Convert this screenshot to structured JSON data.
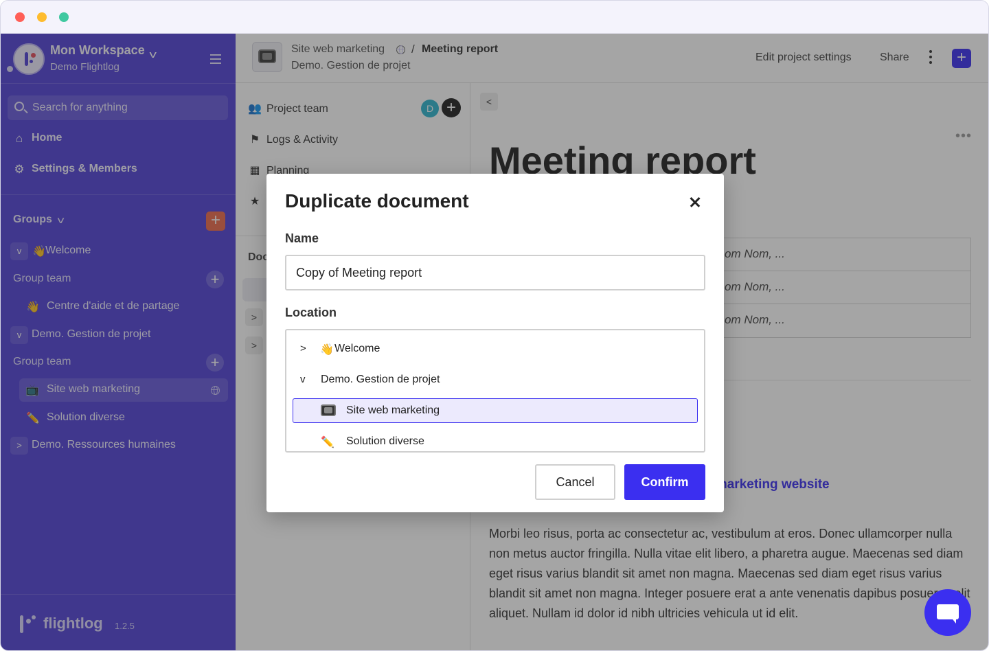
{
  "window": {
    "title_bar": ""
  },
  "workspace": {
    "name": "Mon Workspace",
    "sub": "Demo Flightlog"
  },
  "sidebar": {
    "search_placeholder": "Search for anything",
    "nav": [
      {
        "label": "Home",
        "icon": "home-icon"
      },
      {
        "label": "Settings & Members",
        "icon": "gear-icon"
      }
    ],
    "groups_label": "Groups",
    "tree": [
      {
        "label": "Welcome",
        "emoji": "👋"
      },
      {
        "label": "Group team"
      },
      {
        "label": "Centre d'aide et de partage",
        "emoji": "👋"
      },
      {
        "label": "Demo. Gestion de projet"
      },
      {
        "label": "Group team"
      },
      {
        "label": "Site web marketing",
        "emoji": "📺"
      },
      {
        "label": "Solution diverse",
        "emoji": "✏️"
      },
      {
        "label": "Demo. Ressources humaines"
      }
    ],
    "brand": {
      "name": "flightlog",
      "version": "1.2.5"
    }
  },
  "topbar": {
    "breadcrumb_project": "Site web marketing",
    "breadcrumb_separator": "/",
    "breadcrumb_doc": "Meeting report",
    "breadcrumb_sub": "Demo. Gestion de projet",
    "edit_settings": "Edit project settings",
    "share": "Share"
  },
  "subpanel": {
    "items": [
      {
        "label": "Project team",
        "icon": "team-icon"
      },
      {
        "label": "Logs & Activity",
        "icon": "flag-icon"
      },
      {
        "label": "Planning",
        "icon": "calendar-icon"
      }
    ],
    "avatar_initial": "D",
    "docs_label": "Doc"
  },
  "document": {
    "title": "Meeting report",
    "table_cells": [
      "om Nom, ...",
      "om Nom, ...",
      "om Nom, ..."
    ],
    "link_text": "e marketing website",
    "paragraph": "Morbi leo risus, porta ac consectetur ac, vestibulum at eros. Donec ullamcorper nulla non metus auctor fringilla. Nulla vitae elit libero, a pharetra augue. Maecenas sed diam eget risus varius blandit sit amet non magna. Maecenas sed diam eget risus varius blandit sit amet non magna. Integer posuere erat a ante venenatis dapibus posuere velit aliquet. Nullam id dolor id nibh ultricies vehicula ut id elit."
  },
  "dialog": {
    "title": "Duplicate document",
    "name_label": "Name",
    "name_value": "Copy of Meeting report",
    "location_label": "Location",
    "locations": [
      {
        "label": "Welcome",
        "emoji": "👋",
        "expanded": false
      },
      {
        "label": "Demo. Gestion de projet",
        "expanded": true
      },
      {
        "label": "Site web marketing",
        "selected": true
      },
      {
        "label": "Solution diverse",
        "emoji": "✏️"
      }
    ],
    "cancel": "Cancel",
    "confirm": "Confirm"
  },
  "colors": {
    "sidebar": "#5242d6",
    "accent": "#3b2ff0",
    "orange": "#ec6a4a"
  }
}
